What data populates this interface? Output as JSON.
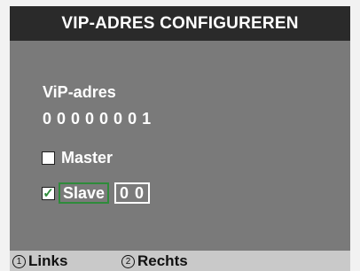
{
  "header": {
    "title": "VIP-ADRES CONFIGUREREN"
  },
  "address": {
    "label": "ViP-adres",
    "value": "0 0 0 0 0 0 0 1"
  },
  "options": {
    "master": {
      "label": "Master",
      "checked": false,
      "mark": ""
    },
    "slave": {
      "label": "Slave",
      "checked": true,
      "mark": "✓",
      "id": "0 0"
    }
  },
  "softkeys": [
    {
      "number": "1",
      "label": "Links"
    },
    {
      "number": "2",
      "label": "Rechts"
    }
  ],
  "colors": {
    "title_bar": "#2a2a2a",
    "screen_bg": "#7a7a7a",
    "bottom_bar": "#c9c9c9",
    "selection": "#2e8b3a"
  }
}
